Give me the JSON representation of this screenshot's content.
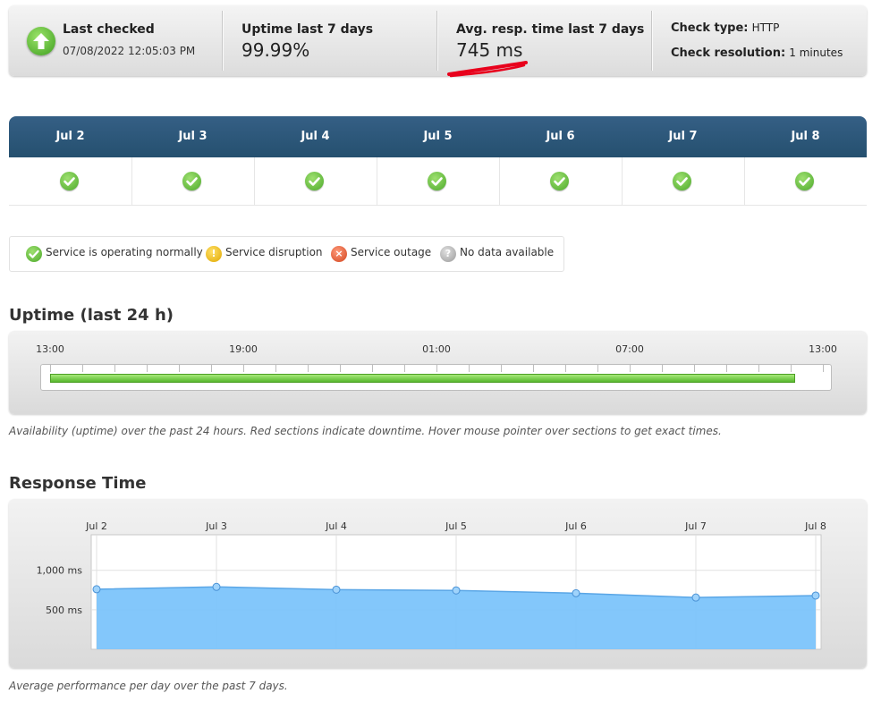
{
  "summary": {
    "last_checked_label": "Last checked",
    "last_checked_value": "07/08/2022 12:05:03 PM",
    "uptime_label": "Uptime last 7 days",
    "uptime_value": "99.99%",
    "resp_label": "Avg. resp. time last 7 days",
    "resp_value": "745 ms",
    "check_type_label": "Check type:",
    "check_type_value": "HTTP",
    "check_res_label": "Check resolution:",
    "check_res_value": "1 minutes",
    "status_icon": "arrow-up-icon",
    "annotation_color": "#e8001c"
  },
  "days": [
    {
      "label": "Jul 2",
      "status": "ok"
    },
    {
      "label": "Jul 3",
      "status": "ok"
    },
    {
      "label": "Jul 4",
      "status": "ok"
    },
    {
      "label": "Jul 5",
      "status": "ok"
    },
    {
      "label": "Jul 6",
      "status": "ok"
    },
    {
      "label": "Jul 7",
      "status": "ok"
    },
    {
      "label": "Jul 8",
      "status": "ok"
    }
  ],
  "legend": {
    "normal": "Service is operating normally",
    "disruption": "Service disruption",
    "outage": "Service outage",
    "nodata": "No data available"
  },
  "uptime": {
    "title": "Uptime (last 24 h)",
    "ticks": [
      "13:00",
      "19:00",
      "01:00",
      "07:00",
      "13:00"
    ],
    "caption": "Availability (uptime) over the past 24 hours. Red sections indicate downtime. Hover mouse pointer over sections to get exact times.",
    "bar_color": "#7fd24f"
  },
  "response": {
    "title": "Response Time",
    "caption": "Average performance per day over the past 7 days."
  },
  "chart_data": {
    "type": "area",
    "categories": [
      "Jul 2",
      "Jul 3",
      "Jul 4",
      "Jul 5",
      "Jul 6",
      "Jul 7",
      "Jul 8"
    ],
    "values": [
      760,
      790,
      755,
      745,
      710,
      655,
      680
    ],
    "y_ticks": [
      {
        "value": 1000,
        "label": "1,000 ms"
      },
      {
        "value": 500,
        "label": "500 ms"
      }
    ],
    "ylim": [
      0,
      1450
    ],
    "fill_color": "#7cc4fb",
    "line_color": "#5aa6e6",
    "grid": true
  }
}
